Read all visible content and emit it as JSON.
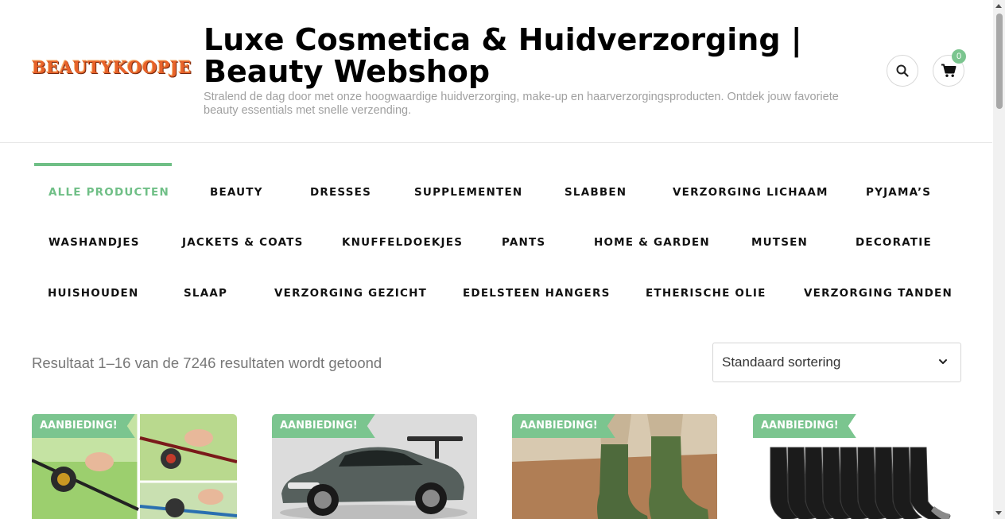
{
  "header": {
    "logo_text": "BEAUTYKOOPJE",
    "site_title": "Luxe Cosmetica & Huidverzorging | Beauty Webshop",
    "tagline": "Stralend de dag door met onze hoogwaardige huidverzorging, make-up en haarverzorgingsproducten. Ontdek jouw favoriete beauty essentials met snelle verzending.",
    "cart_count": "0"
  },
  "nav": {
    "items": [
      "ALLE PRODUCTEN",
      "BEAUTY",
      "DRESSES",
      "SUPPLEMENTEN",
      "SLABBEN",
      "VERZORGING LICHAAM",
      "PYJAMA’S",
      "WASHANDJES",
      "JACKETS & COATS",
      "KNUFFELDOEKJES",
      "PANTS",
      "HOME & GARDEN",
      "MUTSEN",
      "DECORATIE",
      "HUISHOUDEN",
      "SLAAP",
      "VERZORGING GEZICHT",
      "EDELSTEEN HANGERS",
      "ETHERISCHE OLIE",
      "VERZORGING TANDEN"
    ],
    "active": "ALLE PRODUCTEN"
  },
  "results": {
    "count_text": "Resultaat 1–16 van de 7246 resultaten wordt getoond",
    "sort_selected": "Standaard sortering"
  },
  "products": [
    {
      "badge": "AANBIEDING!"
    },
    {
      "badge": "AANBIEDING!"
    },
    {
      "badge": "AANBIEDING!"
    },
    {
      "badge": "AANBIEDING!"
    }
  ],
  "colors": {
    "accent": "#6fbf86",
    "badge": "#7bc58f",
    "logo": "#e8622a"
  }
}
